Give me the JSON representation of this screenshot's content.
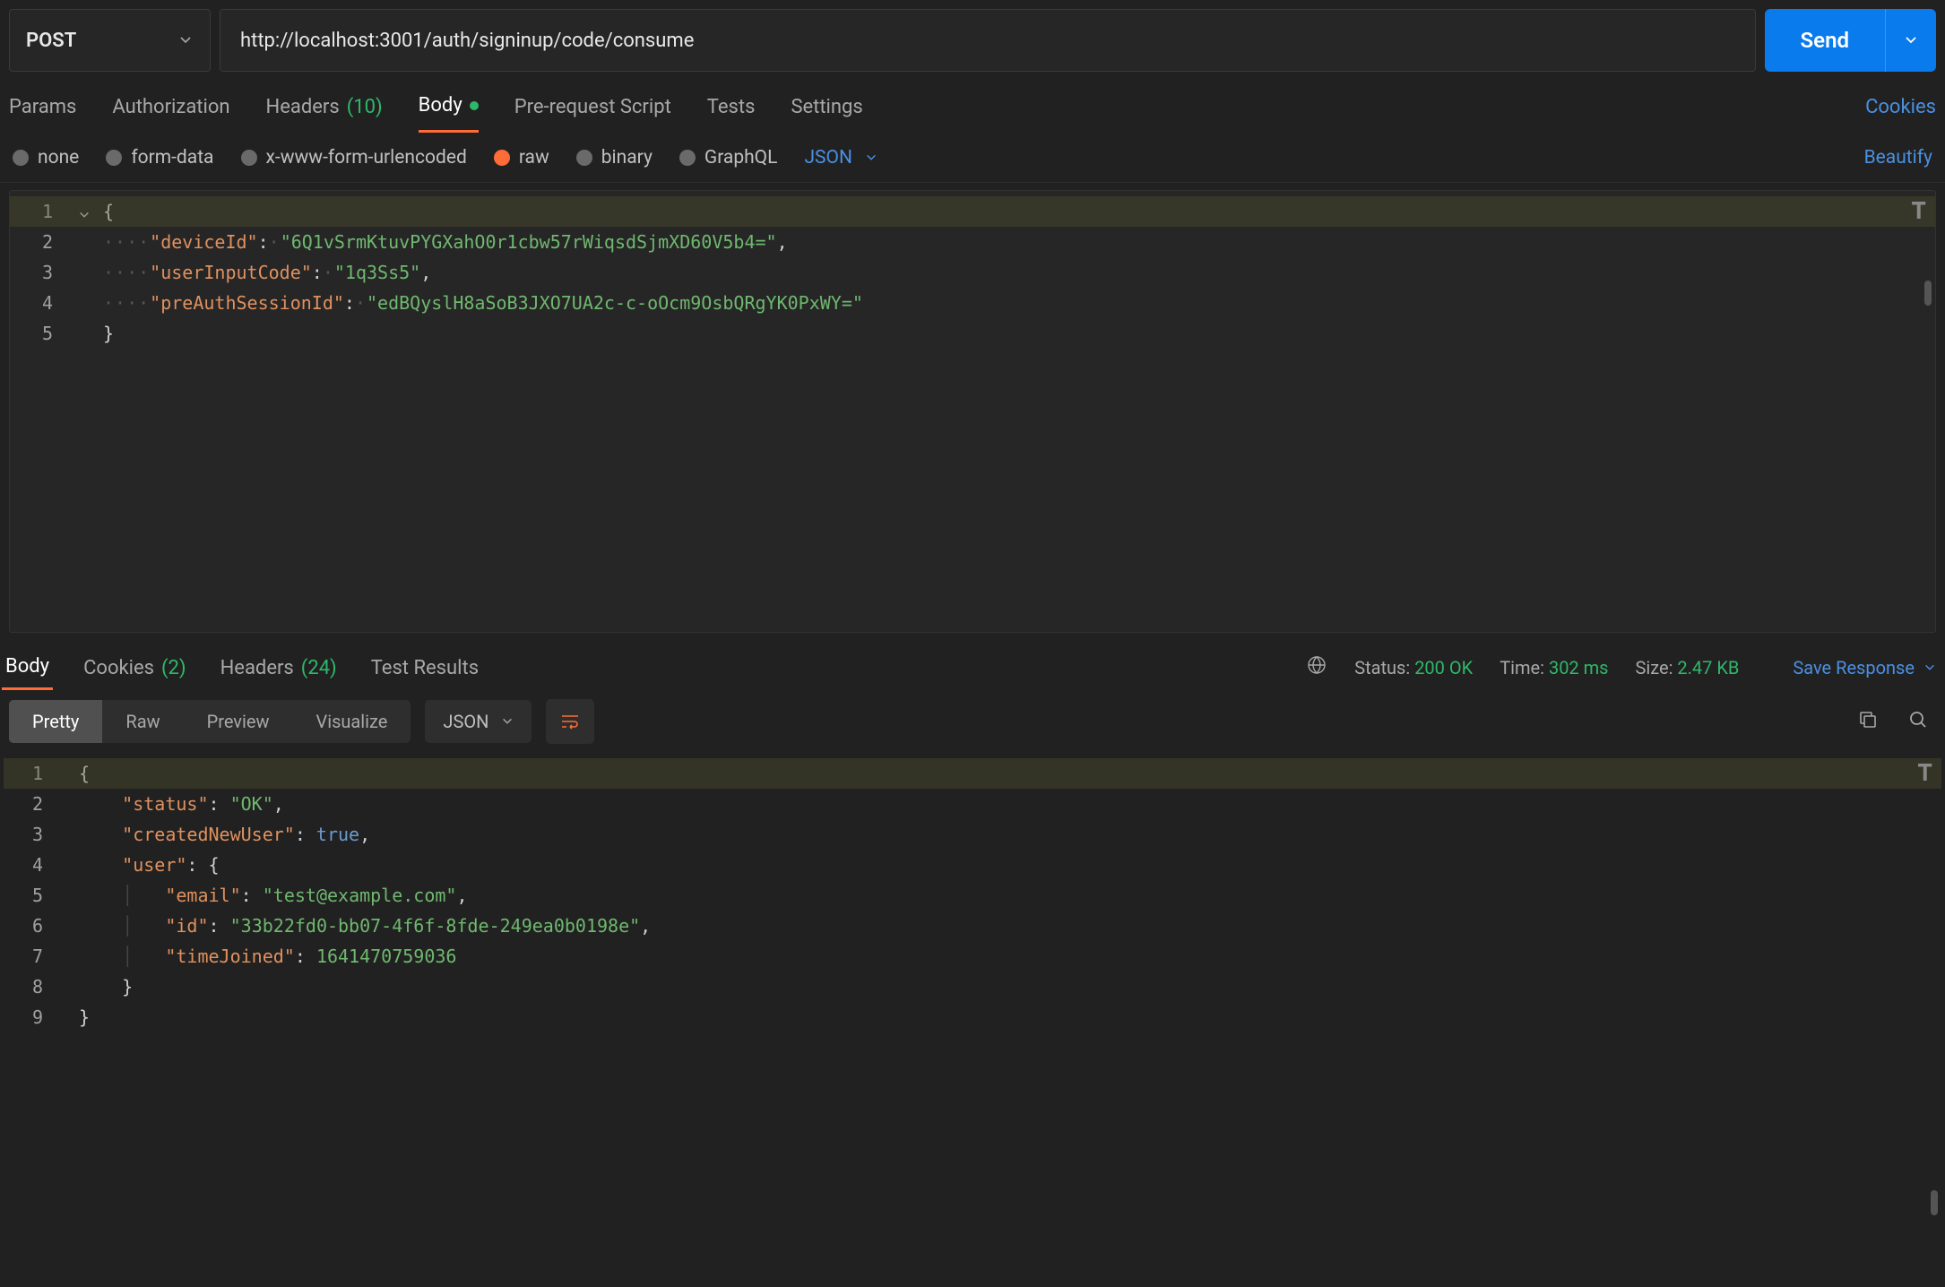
{
  "request": {
    "method": "POST",
    "url": "http://localhost:3001/auth/signinup/code/consume",
    "send_label": "Send"
  },
  "tabs": {
    "params": "Params",
    "authorization": "Authorization",
    "headers": "Headers",
    "headers_count": "(10)",
    "body": "Body",
    "prerequest": "Pre-request Script",
    "tests": "Tests",
    "settings": "Settings",
    "cookies_link": "Cookies"
  },
  "body_types": {
    "none": "none",
    "form_data": "form-data",
    "urlencoded": "x-www-form-urlencoded",
    "raw": "raw",
    "binary": "binary",
    "graphql": "GraphQL",
    "format": "JSON",
    "beautify": "Beautify"
  },
  "request_body": {
    "lines": [
      "1",
      "2",
      "3",
      "4",
      "5"
    ],
    "k_deviceId": "\"deviceId\"",
    "v_deviceId": "\"6Q1vSrmKtuvPYGXahO0r1cbw57rWiqsdSjmXD60V5b4=\"",
    "k_userInputCode": "\"userInputCode\"",
    "v_userInputCode": "\"1q3Ss5\"",
    "k_preAuthSessionId": "\"preAuthSessionId\"",
    "v_preAuthSessionId": "\"edBQyslH8aSoB3JXO7UA2c-c-oOcm9OsbQRgYK0PxWY=\""
  },
  "response_tabs": {
    "body": "Body",
    "cookies": "Cookies",
    "cookies_count": "(2)",
    "headers": "Headers",
    "headers_count": "(24)",
    "test_results": "Test Results"
  },
  "response_meta": {
    "status_label": "Status:",
    "status_value": "200 OK",
    "time_label": "Time:",
    "time_value": "302 ms",
    "size_label": "Size:",
    "size_value": "2.47 KB",
    "save": "Save Response"
  },
  "view_modes": {
    "pretty": "Pretty",
    "raw": "Raw",
    "preview": "Preview",
    "visualize": "Visualize",
    "format": "JSON"
  },
  "response_body": {
    "lines": [
      "1",
      "2",
      "3",
      "4",
      "5",
      "6",
      "7",
      "8",
      "9"
    ],
    "k_status": "\"status\"",
    "v_status": "\"OK\"",
    "k_createdNewUser": "\"createdNewUser\"",
    "v_createdNewUser": "true",
    "k_user": "\"user\"",
    "k_email": "\"email\"",
    "v_email": "\"test@example.com\"",
    "k_id": "\"id\"",
    "v_id": "\"33b22fd0-bb07-4f6f-8fde-249ea0b0198e\"",
    "k_timeJoined": "\"timeJoined\"",
    "v_timeJoined": "1641470759036"
  }
}
